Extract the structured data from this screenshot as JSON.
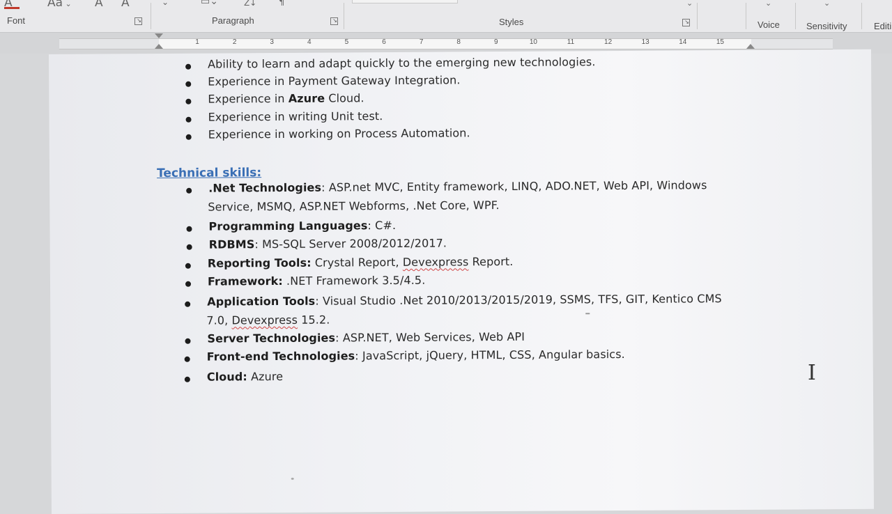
{
  "ribbon": {
    "groups": {
      "font": "Font",
      "paragraph": "Paragraph",
      "styles": "Styles",
      "voice": "Voice",
      "sensitivity": "Sensitivity",
      "editing": "Editi"
    },
    "font_icons": [
      "A",
      "Aa",
      "A",
      "A"
    ],
    "sort_label": "Z↓",
    "pilcrow": "¶"
  },
  "ruler": {
    "numbers": [
      "1",
      "2",
      "3",
      "4",
      "5",
      "6",
      "7",
      "8",
      "9",
      "10",
      "11",
      "12",
      "13",
      "14",
      "15"
    ]
  },
  "document": {
    "experience_items": [
      {
        "text": "Ability to learn and adapt quickly to the emerging new technologies."
      },
      {
        "text": "Experience in Payment Gateway Integration."
      },
      {
        "pre": "Experience in ",
        "bold": "Azure",
        "post": " Cloud."
      },
      {
        "text": "Experience in writing Unit test."
      },
      {
        "text": "Experience in working on Process Automation."
      }
    ],
    "skills_heading": "Technical skills:",
    "skills": [
      {
        "label": ".Net Technologies",
        "sep": ":  ",
        "value": "ASP.net MVC, Entity framework, LINQ, ADO.NET, Web API, Windows",
        "cont": "Service, MSMQ, ASP.NET Webforms, .Net Core, WPF."
      },
      {
        "label": "Programming Languages",
        "sep": ": ",
        "value": "C#."
      },
      {
        "label": "RDBMS",
        "sep": ": ",
        "value": "MS-SQL Server 2008/2012/2017."
      },
      {
        "label": "Reporting Tools:",
        "sep": " ",
        "value_pre": "Crystal Report, ",
        "value_squiggle": "Devexpress",
        "value_post": " Report."
      },
      {
        "label": "Framework:",
        "sep": "  ",
        "value": ".NET Framework 3.5/4.5."
      },
      {
        "label": "Application Tools",
        "sep": ": ",
        "value": "Visual Studio .Net 2010/2013/2015/2019, SSMS, TFS, GIT, Kentico CMS",
        "cont_pre": "7.0, ",
        "cont_squiggle": "Devexpress",
        "cont_post": " 15.2."
      },
      {
        "label": "Server Technologies",
        "sep": ": ",
        "value": "ASP.NET, Web Services, Web API"
      },
      {
        "label": "Front-end Technologies",
        "sep": ": ",
        "value": "JavaScript, jQuery, HTML, CSS, Angular basics."
      },
      {
        "label": "Cloud:",
        "sep": " ",
        "value": "Azure"
      }
    ]
  },
  "cursor": "I",
  "colors": {
    "heading": "#3a6fb5",
    "spell_squiggle": "#d04444",
    "font_color_bar": "#c0392b"
  }
}
